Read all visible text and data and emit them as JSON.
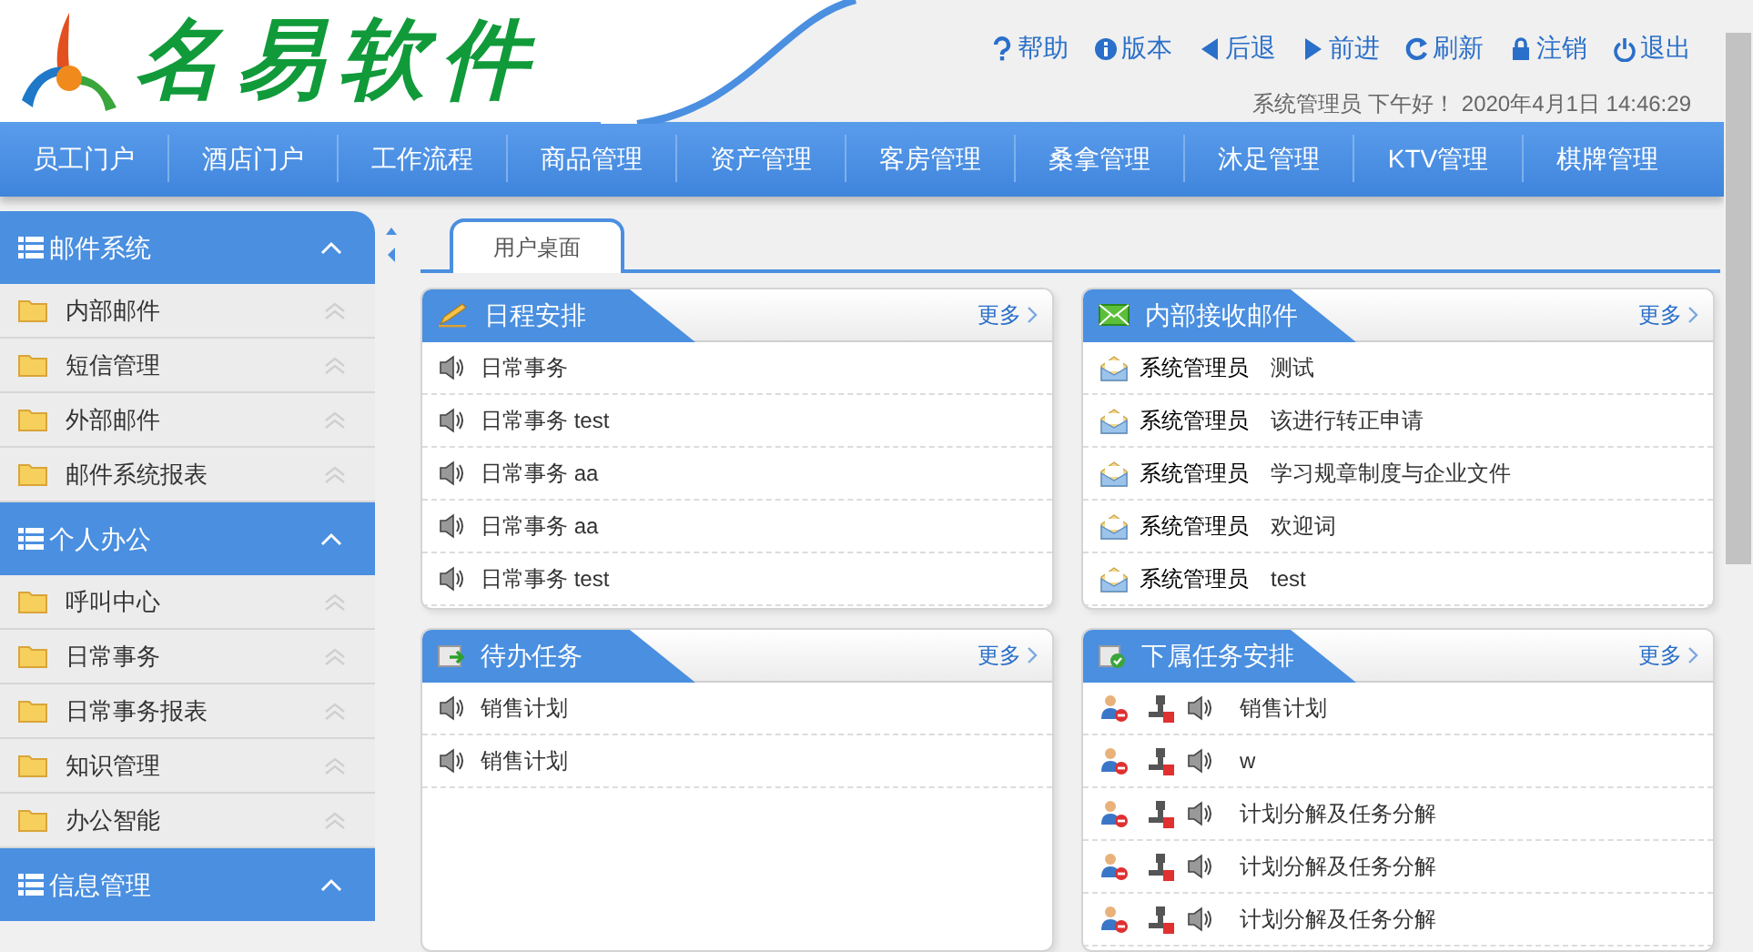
{
  "logo": {
    "text": "名易软件"
  },
  "toolbar": [
    {
      "label": "帮助",
      "kind": "help"
    },
    {
      "label": "版本",
      "kind": "info"
    },
    {
      "label": "后退",
      "kind": "back"
    },
    {
      "label": "前进",
      "kind": "forward"
    },
    {
      "label": "刷新",
      "kind": "refresh"
    },
    {
      "label": "注销",
      "kind": "lock"
    },
    {
      "label": "退出",
      "kind": "power"
    }
  ],
  "greeting": "系统管理员 下午好！ 2020年4月1日 14:46:29",
  "nav": [
    "员工门户",
    "酒店门户",
    "工作流程",
    "商品管理",
    "资产管理",
    "客房管理",
    "桑拿管理",
    "沐足管理",
    "KTV管理",
    "棋牌管理"
  ],
  "sidebar": {
    "groups": [
      {
        "title": "邮件系统",
        "expanded": true,
        "items": [
          "内部邮件",
          "短信管理",
          "外部邮件",
          "邮件系统报表"
        ]
      },
      {
        "title": "个人办公",
        "expanded": true,
        "items": [
          "呼叫中心",
          "日常事务",
          "日常事务报表",
          "知识管理",
          "办公智能"
        ]
      },
      {
        "title": "信息管理",
        "expanded": true
      }
    ]
  },
  "tabs": [
    {
      "label": "用户桌面",
      "selected": true
    }
  ],
  "panels": [
    {
      "kind": "schedule",
      "title": "日程安排",
      "more": "更多",
      "rows": [
        {
          "text": "日常事务"
        },
        {
          "text": "日常事务 test"
        },
        {
          "text": "日常事务 aa"
        },
        {
          "text": "日常事务 aa"
        },
        {
          "text": "日常事务 test"
        }
      ]
    },
    {
      "kind": "mail",
      "title": "内部接收邮件",
      "more": "更多",
      "rows": [
        {
          "sender": "系统管理员",
          "text": "测试"
        },
        {
          "sender": "系统管理员",
          "text": "该进行转正申请"
        },
        {
          "sender": "系统管理员",
          "text": "学习规章制度与企业文件"
        },
        {
          "sender": "系统管理员",
          "text": "欢迎词"
        },
        {
          "sender": "系统管理员",
          "text": "test"
        }
      ]
    },
    {
      "kind": "todo",
      "title": "待办任务",
      "more": "更多",
      "rows": [
        {
          "text": "销售计划"
        },
        {
          "text": "销售计划"
        }
      ]
    },
    {
      "kind": "subordinate",
      "title": "下属任务安排",
      "more": "更多",
      "rows": [
        {
          "text": "销售计划"
        },
        {
          "text": "w"
        },
        {
          "text": "计划分解及任务分解"
        },
        {
          "text": "计划分解及任务分解"
        },
        {
          "text": "计划分解及任务分解"
        }
      ]
    }
  ]
}
